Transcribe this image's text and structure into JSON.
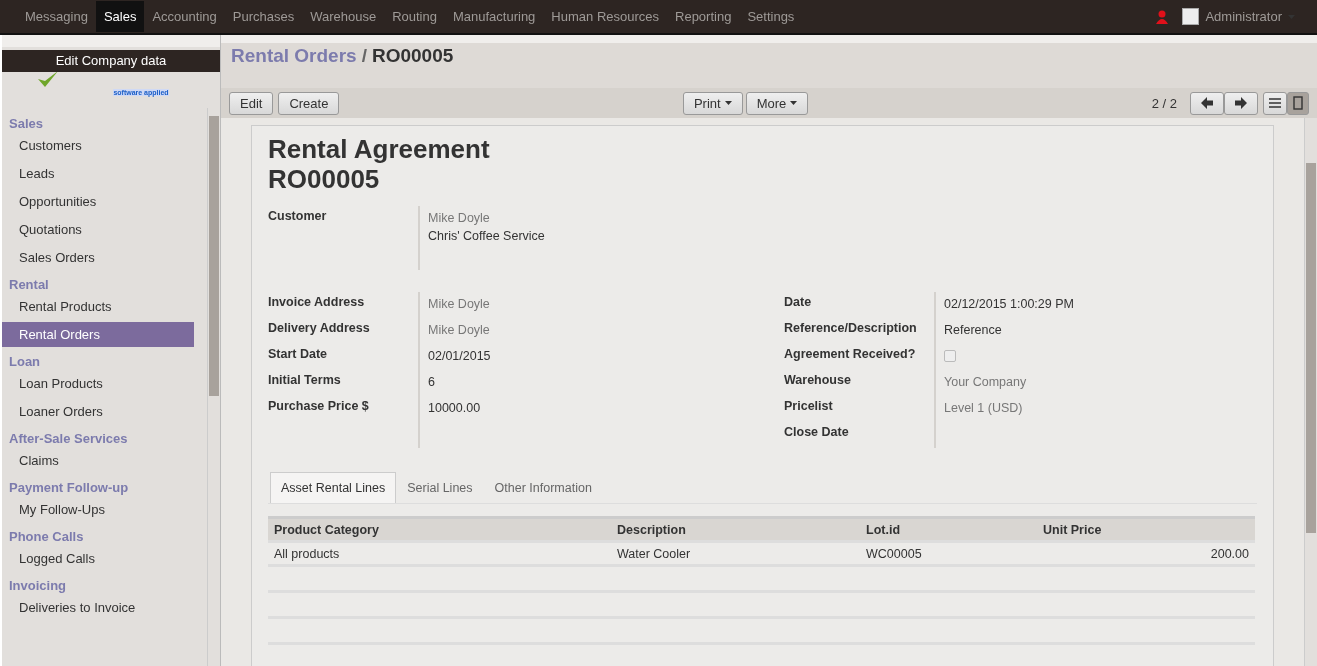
{
  "top_menu": [
    {
      "label": "Messaging",
      "selected": false
    },
    {
      "label": "Sales",
      "selected": true
    },
    {
      "label": "Accounting",
      "selected": false
    },
    {
      "label": "Purchases",
      "selected": false
    },
    {
      "label": "Warehouse",
      "selected": false
    },
    {
      "label": "Routing",
      "selected": false
    },
    {
      "label": "Manufacturing",
      "selected": false
    },
    {
      "label": "Human Resources",
      "selected": false
    },
    {
      "label": "Reporting",
      "selected": false
    },
    {
      "label": "Settings",
      "selected": false
    }
  ],
  "user": {
    "name": "Administrator"
  },
  "logo": {
    "tooltip": "Edit Company data",
    "tagline": "software applied"
  },
  "sidebar": [
    {
      "title": "Sales",
      "items": [
        {
          "label": "Customers",
          "selected": false
        },
        {
          "label": "Leads",
          "selected": false
        },
        {
          "label": "Opportunities",
          "selected": false
        },
        {
          "label": "Quotations",
          "selected": false
        },
        {
          "label": "Sales Orders",
          "selected": false
        }
      ]
    },
    {
      "title": "Rental",
      "items": [
        {
          "label": "Rental Products",
          "selected": false
        },
        {
          "label": "Rental Orders",
          "selected": true
        }
      ]
    },
    {
      "title": "Loan",
      "items": [
        {
          "label": "Loan Products",
          "selected": false
        },
        {
          "label": "Loaner Orders",
          "selected": false
        }
      ]
    },
    {
      "title": "After-Sale Services",
      "items": [
        {
          "label": "Claims",
          "selected": false
        }
      ]
    },
    {
      "title": "Payment Follow-up",
      "items": [
        {
          "label": "My Follow-Ups",
          "selected": false
        }
      ]
    },
    {
      "title": "Phone Calls",
      "items": [
        {
          "label": "Logged Calls",
          "selected": false
        }
      ]
    },
    {
      "title": "Invoicing",
      "items": [
        {
          "label": "Deliveries to Invoice",
          "selected": false
        }
      ]
    }
  ],
  "breadcrumb": {
    "parent": "Rental Orders",
    "separator": "/",
    "current": "RO00005"
  },
  "toolbar": {
    "left_buttons": [
      "Edit",
      "Create"
    ],
    "menus": [
      "Print",
      "More"
    ],
    "pager": "2 / 2"
  },
  "form": {
    "title": "Rental Agreement",
    "number": "RO00005",
    "customer": {
      "label": "Customer",
      "lines": [
        {
          "text": "Mike Doyle",
          "kind": "relation"
        },
        {
          "text": "Chris' Coffee Service",
          "kind": "text"
        }
      ]
    },
    "left_fields": [
      {
        "label": "Invoice Address",
        "value": "Mike Doyle",
        "kind": "relation"
      },
      {
        "label": "Delivery Address",
        "value": "Mike Doyle",
        "kind": "relation"
      },
      {
        "label": "Start Date",
        "value": "02/01/2015",
        "kind": "text"
      },
      {
        "label": "Initial Terms",
        "value": "6",
        "kind": "text"
      },
      {
        "label": "Purchase Price $",
        "value": "10000.00",
        "kind": "text"
      }
    ],
    "right_fields": [
      {
        "label": "Date",
        "value": "02/12/2015 1:00:29 PM",
        "kind": "text"
      },
      {
        "label": "Reference/Description",
        "value": "Reference",
        "kind": "text"
      },
      {
        "label": "Agreement Received?",
        "kind": "checkbox",
        "checked": false
      },
      {
        "label": "Warehouse",
        "value": "Your Company",
        "kind": "relation"
      },
      {
        "label": "Pricelist",
        "value": "Level 1 (USD)",
        "kind": "relation"
      },
      {
        "label": "Close Date",
        "kind": "text"
      }
    ],
    "tabs": [
      {
        "label": "Asset Rental Lines",
        "selected": true
      },
      {
        "label": "Serial Lines",
        "selected": false
      },
      {
        "label": "Other Information",
        "selected": false
      }
    ],
    "table": {
      "columns": [
        "Product Category",
        "Description",
        "Lot.id",
        "Unit Price"
      ],
      "rows": [
        [
          "All products",
          "Water Cooler",
          "WC00005",
          "200.00"
        ]
      ]
    }
  }
}
